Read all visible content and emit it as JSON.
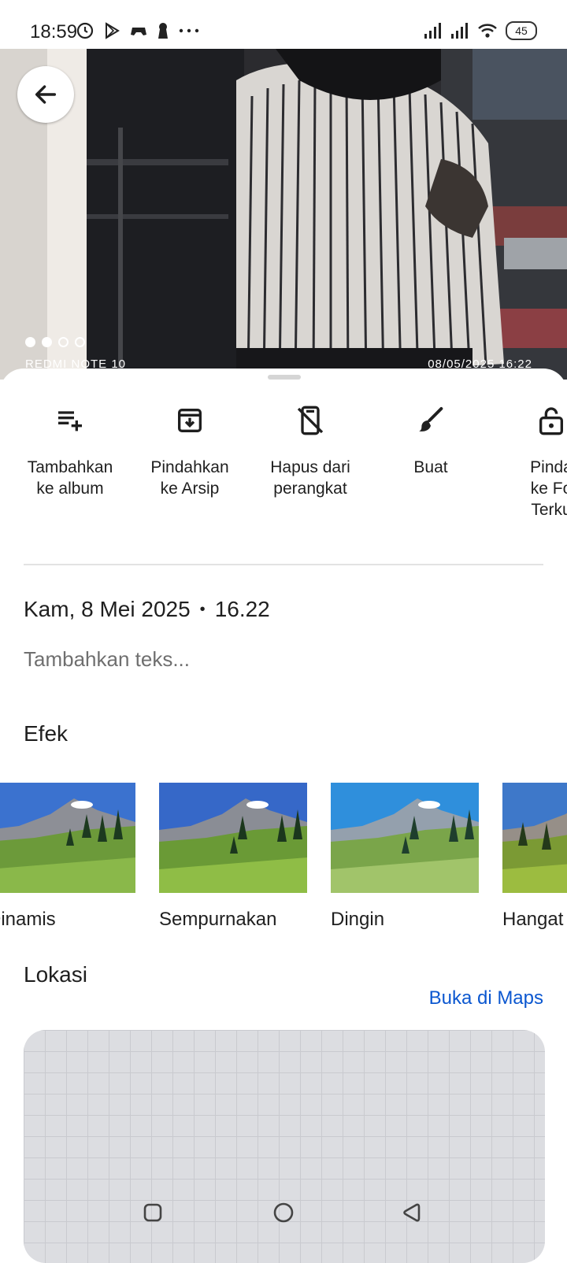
{
  "status_bar": {
    "time": "18:59",
    "left_icons": [
      "clock-icon",
      "play-store-icon",
      "gamepad-icon",
      "keyhole-icon",
      "more-dots-icon"
    ],
    "right_icons": [
      "signal-icon",
      "signal-icon",
      "wifi-icon",
      "battery-icon"
    ],
    "battery": "45"
  },
  "photo": {
    "watermark_left": "REDMI NOTE 10",
    "watermark_right": "08/05/2025 16:22",
    "pager_dots": [
      "filled",
      "filled",
      "empty",
      "empty"
    ]
  },
  "actions": [
    {
      "label": "Tambahkan\nke album",
      "icon": "playlist-add-icon"
    },
    {
      "label": "Pindahkan\nke Arsip",
      "icon": "archive-icon"
    },
    {
      "label": "Hapus dari\nperangkat",
      "icon": "phone-off-icon"
    },
    {
      "label": "Buat",
      "icon": "brush-icon"
    },
    {
      "label": "Pinda\nke Fo\nTerku",
      "icon": "lock-icon"
    }
  ],
  "details": {
    "date": "Kam, 8 Mei 2025",
    "separator": "•",
    "time": "16.22",
    "add_text_placeholder": "Tambahkan teks..."
  },
  "effects": {
    "title": "Efek",
    "items": [
      {
        "label": "Dinamis"
      },
      {
        "label": "Sempurnakan"
      },
      {
        "label": "Dingin"
      },
      {
        "label": "Hangat"
      }
    ]
  },
  "location": {
    "title": "Lokasi",
    "open_maps": "Buka di Maps"
  },
  "nav": [
    "recents-icon",
    "home-icon",
    "back-icon"
  ],
  "colors": {
    "link": "#0b57d0",
    "text": "#1f1f1f",
    "muted": "#6f6f6f"
  }
}
